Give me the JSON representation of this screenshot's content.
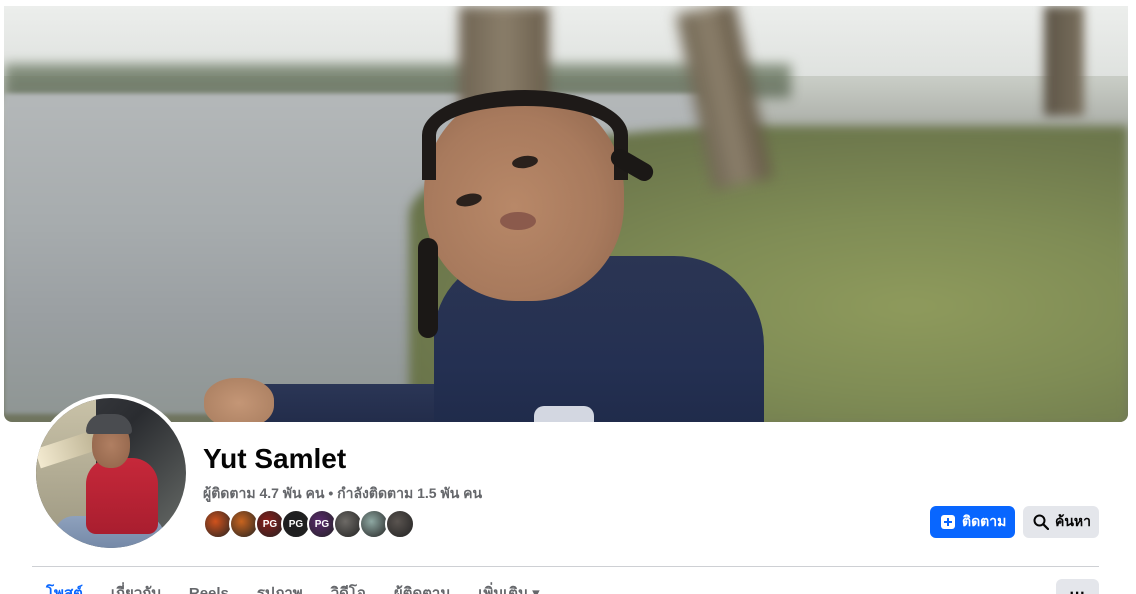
{
  "profile": {
    "name": "Yut Samlet",
    "stats": "ผู้ติดตาม 4.7 พัน คน • กำลังติดตาม 1.5 พัน คน"
  },
  "actions": {
    "follow_label": "ติดตาม",
    "search_label": "ค้นหา"
  },
  "follower_avatars": [
    {
      "label": "",
      "color": "#d0521d"
    },
    {
      "label": "",
      "color": "#c8641f"
    },
    {
      "label": "PG",
      "color": "#8a1e1a"
    },
    {
      "label": "PG",
      "color": "#1d1d1f"
    },
    {
      "label": "PG",
      "color": "#5a2a6e"
    },
    {
      "label": "",
      "color": "#6d6a66"
    },
    {
      "label": "",
      "color": "#8ea8a2"
    },
    {
      "label": "",
      "color": "#5a5450"
    }
  ],
  "tabs": [
    {
      "label": "โพสต์",
      "active": true
    },
    {
      "label": "เกี่ยวกับ",
      "active": false
    },
    {
      "label": "Reels",
      "active": false
    },
    {
      "label": "รูปภาพ",
      "active": false
    },
    {
      "label": "วิดีโอ",
      "active": false
    },
    {
      "label": "ผู้ติดตาม",
      "active": false
    },
    {
      "label": "เพิ่มเติม ▾",
      "active": false
    }
  ],
  "more_label": "···",
  "colors": {
    "primary": "#0866ff",
    "secondary_bg": "#e4e6eb",
    "muted_text": "#65676b"
  }
}
